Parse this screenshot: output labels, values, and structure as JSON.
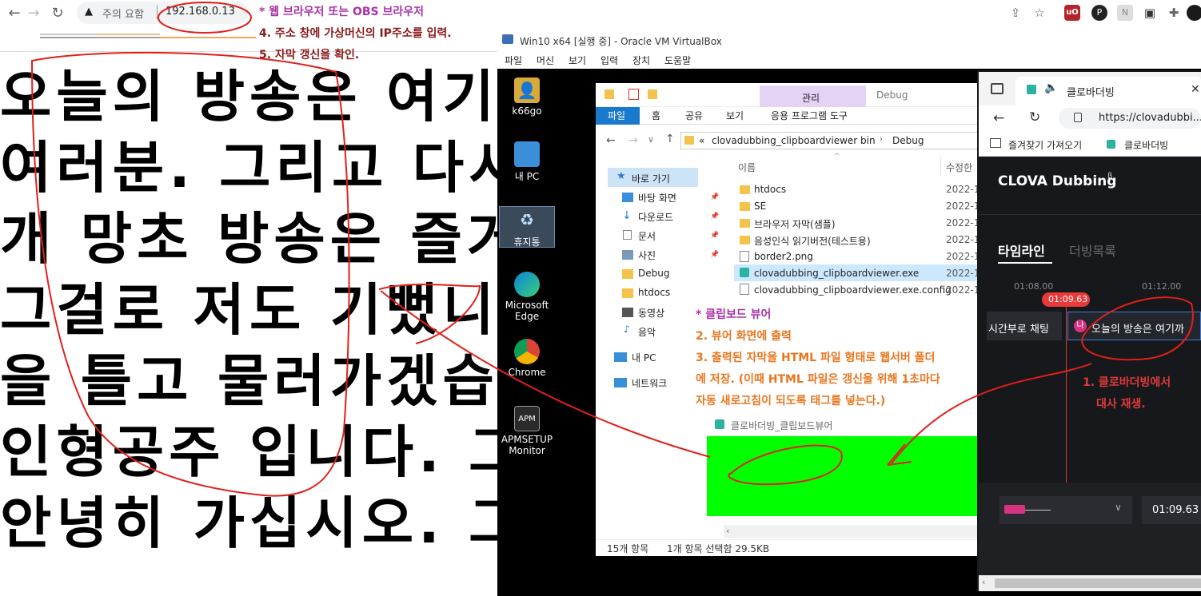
{
  "host_browser": {
    "addr_warning": "주의 요함",
    "addr_url": "192.168.0.13"
  },
  "broadcast_lines": [
    "오늘의 방송은 여기",
    "여러분. 그리고 다시",
    "개 망초 방송은 즐거",
    "그걸로 저도 기뻤니",
    "을 틀고 물러가겠습",
    "인형공주 입니다. 그",
    "안녕히 가십시오. 그"
  ],
  "annotations": {
    "browser_note_1": "* 웹 브라우저 또는 OBS 브라우저",
    "browser_note_2": "4. 주소 창에 가상머신의 IP주소를 입력.",
    "browser_note_3": "5. 자막 갱신을 확인.",
    "viewer_note_1": "* 클립보드 뷰어",
    "viewer_note_2": "2. 뷰어 화면에 출력",
    "viewer_note_3": "3. 출력된 자막을 HTML 파일 형태로 웹서버 폴더",
    "viewer_note_4": "에 저장. (이때 HTML 파일은 갱신을 위해 1초마다",
    "viewer_note_5": "자동 새로고침이 되도록 태그를 넣는다.)",
    "clova_note_1": "1. 클로바더빙에서",
    "clova_note_2": "대사 재생."
  },
  "virtualbox": {
    "title": "Win10 x64 [실행 중] - Oracle VM VirtualBox",
    "menu": [
      "파일",
      "머신",
      "보기",
      "입력",
      "장치",
      "도움말"
    ]
  },
  "desktop_icons": [
    {
      "label": "k66go"
    },
    {
      "label": "내 PC"
    },
    {
      "label": "휴지통"
    },
    {
      "label": "Microsoft Edge"
    },
    {
      "label": "Chrome"
    },
    {
      "label": "APMSETUP Monitor"
    }
  ],
  "explorer": {
    "manage_tab": "관리",
    "debug_title": "Debug",
    "ribbon_tabs": [
      "파일",
      "홈",
      "공유",
      "보기",
      "응용 프로그램 도구"
    ],
    "path": [
      "«",
      "clovadubbing_clipboardviewer",
      "bin",
      "Debug"
    ],
    "col_name": "이름",
    "col_modified": "수정한",
    "sidebar": [
      "바로 가기",
      "바탕 화면",
      "다운로드",
      "문서",
      "사진",
      "Debug",
      "htdocs",
      "동영상",
      "음악",
      "내 PC",
      "네트워크"
    ],
    "files": [
      {
        "name": "htdocs",
        "date": "2022-1"
      },
      {
        "name": "SE",
        "date": "2022-1"
      },
      {
        "name": "브라우저 자막(샘플)",
        "date": "2022-1"
      },
      {
        "name": "음성인식 읽기버전(테스트용)",
        "date": "2022-1"
      },
      {
        "name": "border2.png",
        "date": "2022-1"
      },
      {
        "name": "clovadubbing_clipboardviewer.exe",
        "date": "2022-1"
      },
      {
        "name": "clovadubbing_clipboardviewer.exe.config",
        "date": "2022-1"
      }
    ],
    "status_count": "15개 항목",
    "status_selected": "1개 항목 선택함 29.5KB"
  },
  "viewer_window": {
    "title": "클로바더빙_클립보드뷰어",
    "screen_color": "#00ff00"
  },
  "edge": {
    "tab_title": "클로바더빙",
    "url": "https://clovadubbi...",
    "fav_import": "즐겨찾기 가져오기",
    "fav_clova": "클로바더빙",
    "logo": "CLOVA Dubbing",
    "logo_beta": "β",
    "tab_timeline": "타임라인",
    "tab_dub_list": "더빙목록",
    "time_1": "01:08.00",
    "time_2": "01:12.00",
    "playhead": "01:09.63",
    "clip_left": "시간부로 채팅",
    "clip_badge": "나",
    "clip_text": "오늘의 방송은 여기까",
    "bottom_time": "01:09.63"
  }
}
